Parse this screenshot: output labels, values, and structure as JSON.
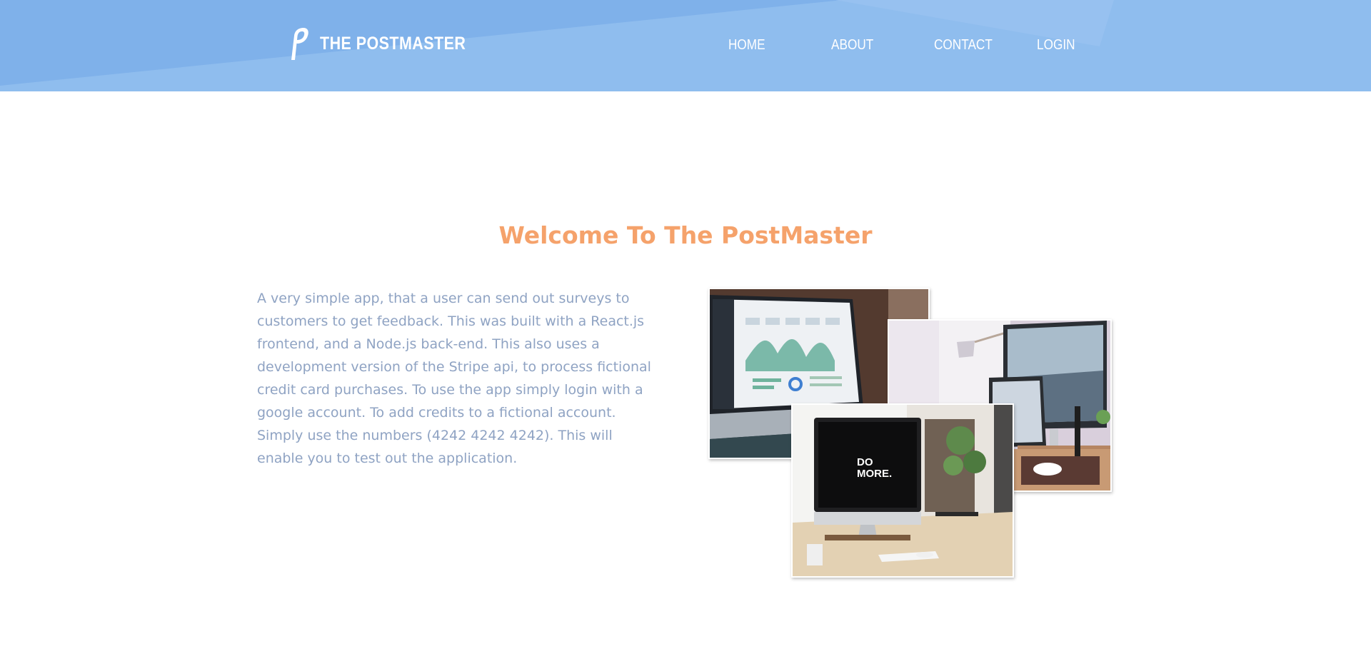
{
  "header": {
    "brand_mark": "P",
    "brand_name": "THE POSTMASTER"
  },
  "nav": {
    "items": [
      {
        "id": "home",
        "label": "HOME"
      },
      {
        "id": "about",
        "label": "ABOUT"
      },
      {
        "id": "contact",
        "label": "CONTACT"
      },
      {
        "id": "login",
        "label": "LOGIN"
      }
    ]
  },
  "main": {
    "title": "Welcome To The PostMaster",
    "intro": "A very simple app, that a user can send out surveys to customers to get feedback. This was built with a React.js frontend, and a Node.js back-end. This also uses a development version of the Stripe api, to process fictional credit card purchases. To use the app simply login with a google account. To add credits to a fictional account. Simply use the numbers (4242 4242 4242). This will enable you to test out the application.",
    "photos": {
      "monitor_text": "DO MORE."
    }
  },
  "colors": {
    "header_bg": "#7fb1ea",
    "title": "#f5a26b",
    "body_text": "#8fa3c3"
  }
}
